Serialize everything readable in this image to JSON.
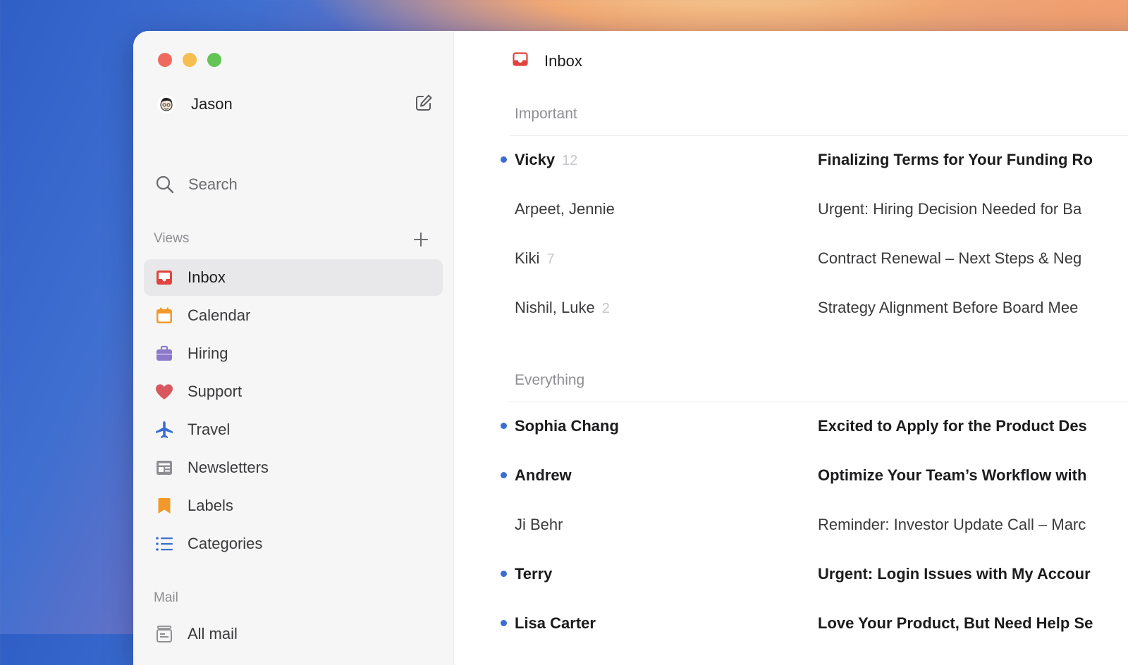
{
  "user": {
    "name": "Jason"
  },
  "search": {
    "label": "Search"
  },
  "views_label": "Views",
  "mail_label": "Mail",
  "views": [
    {
      "label": "Inbox",
      "icon": "inbox-icon",
      "active": true
    },
    {
      "label": "Calendar",
      "icon": "calendar-icon"
    },
    {
      "label": "Hiring",
      "icon": "briefcase-icon"
    },
    {
      "label": "Support",
      "icon": "heart-icon"
    },
    {
      "label": "Travel",
      "icon": "airplane-icon"
    },
    {
      "label": "Newsletters",
      "icon": "newspaper-icon"
    },
    {
      "label": "Labels",
      "icon": "bookmark-icon"
    },
    {
      "label": "Categories",
      "icon": "list-icon"
    }
  ],
  "mail": [
    {
      "label": "All mail",
      "icon": "archive-icon"
    }
  ],
  "main": {
    "title": "Inbox",
    "groups": [
      {
        "title": "Important",
        "rows": [
          {
            "sender": "Vicky",
            "count": "12",
            "subject": "Finalizing Terms for Your Funding Ro",
            "unread": true
          },
          {
            "sender": "Arpeet, Jennie",
            "count": "",
            "subject": "Urgent: Hiring Decision Needed for Ba",
            "unread": false
          },
          {
            "sender": "Kiki",
            "count": "7",
            "subject": "Contract Renewal – Next Steps & Neg",
            "unread": false
          },
          {
            "sender": "Nishil, Luke",
            "count": "2",
            "subject": "Strategy Alignment Before Board Mee",
            "unread": false
          }
        ]
      },
      {
        "title": "Everything",
        "rows": [
          {
            "sender": "Sophia Chang",
            "count": "",
            "subject": "Excited to Apply for the Product Des",
            "unread": true
          },
          {
            "sender": "Andrew",
            "count": "",
            "subject": "Optimize Your Team’s Workflow with",
            "unread": true
          },
          {
            "sender": "Ji Behr",
            "count": "",
            "subject": "Reminder: Investor Update Call – Marc",
            "unread": false
          },
          {
            "sender": "Terry",
            "count": "",
            "subject": "Urgent: Login Issues with My Accour",
            "unread": true
          },
          {
            "sender": "Lisa Carter",
            "count": "",
            "subject": "Love Your Product, But Need Help Se",
            "unread": true
          }
        ]
      }
    ]
  },
  "colors": {
    "accent_blue": "#3a6fd0",
    "inbox_red": "#e0443c"
  }
}
